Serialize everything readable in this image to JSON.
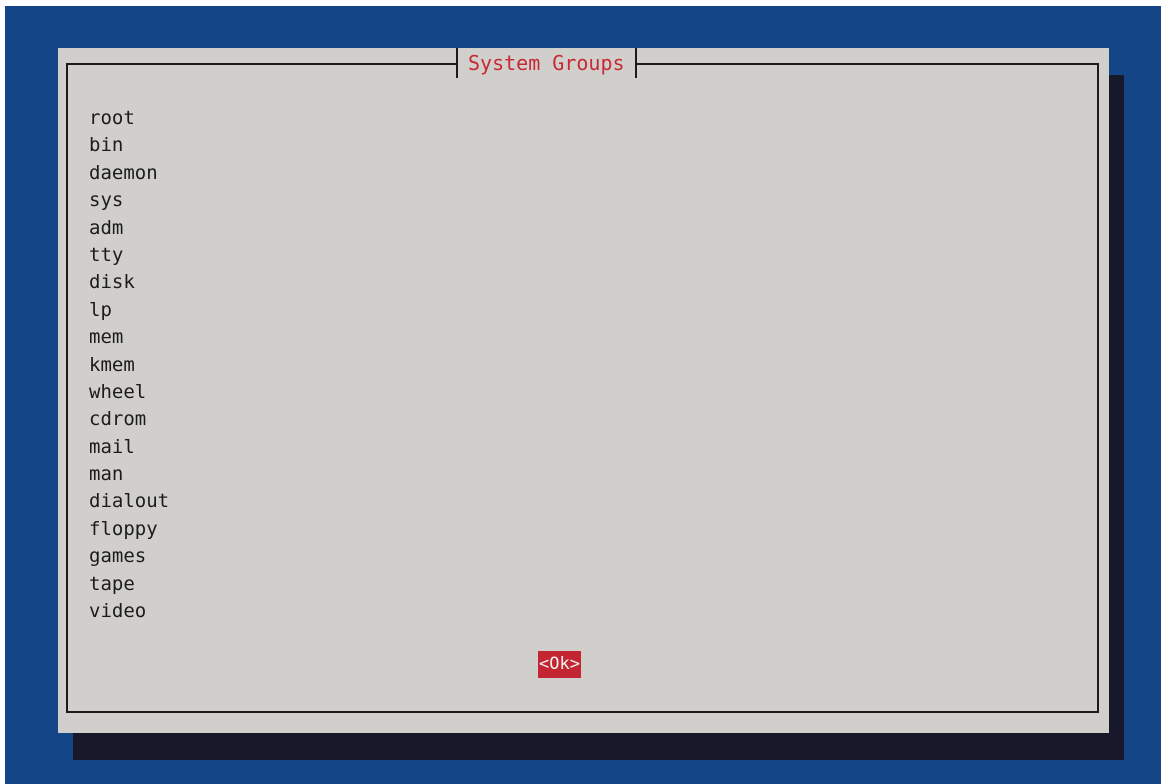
{
  "dialog": {
    "title": "System Groups",
    "groups": [
      "root",
      "bin",
      "daemon",
      "sys",
      "adm",
      "tty",
      "disk",
      "lp",
      "mem",
      "kmem",
      "wheel",
      "cdrom",
      "mail",
      "man",
      "dialout",
      "floppy",
      "games",
      "tape",
      "video"
    ],
    "ok_label": "<Ok>"
  },
  "colors": {
    "screen_background": "#134587",
    "dialog_background": "#d1cfcb",
    "shadow": "#17182a",
    "title_text": "#c62a35",
    "ok_background": "#c42532"
  }
}
